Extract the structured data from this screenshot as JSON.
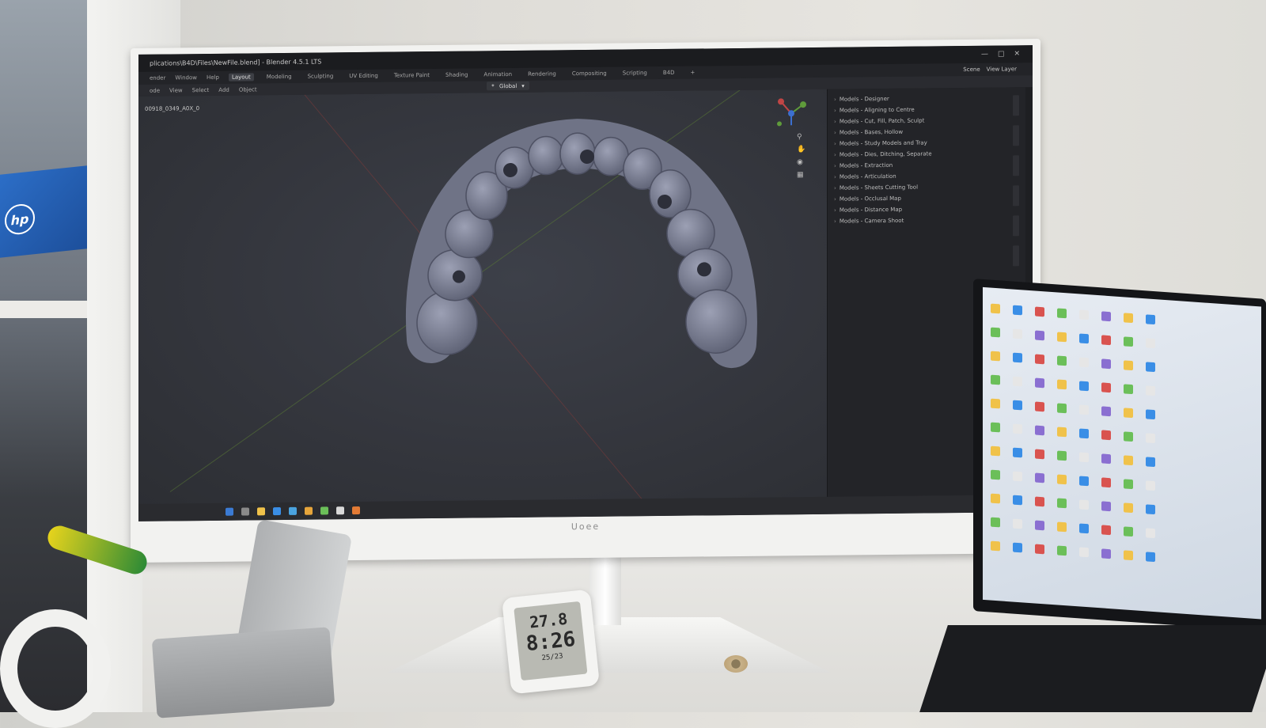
{
  "blender": {
    "window_title": "plications\\B4D\\Files\\NewFile.blend] - Blender 4.5.1 LTS",
    "menu": [
      "ender",
      "Window",
      "Help"
    ],
    "workspaces": [
      "Layout",
      "Modeling",
      "Sculpting",
      "UV Editing",
      "Texture Paint",
      "Shading",
      "Animation",
      "Rendering",
      "Compositing",
      "Scripting",
      "B4D",
      "+"
    ],
    "active_workspace": "Layout",
    "scene_label": "Scene",
    "view_layer_label": "View Layer",
    "header_items": [
      "ode",
      "View",
      "Select",
      "Add",
      "Object"
    ],
    "transform_orientation": "Global",
    "object_name": "00918_0349_A0X_0",
    "side_panel_items": [
      "Models - Designer",
      "Models - Aligning to Centre",
      "Models - Cut, Fill, Patch, Sculpt",
      "Models - Bases, Hollow",
      "Models - Study Models and Tray",
      "Models - Dies, Ditching, Separate",
      "Models - Extraction",
      "Models - Articulation",
      "Models - Sheets Cutting Tool",
      "Models - Occlusal Map",
      "Models - Distance Map",
      "Models - Camera Shoot"
    ],
    "colors": {
      "viewport": "#34363d",
      "panel": "#232428",
      "model": "#7b7f93"
    }
  },
  "monitor": {
    "brand": "Uoee"
  },
  "thermometer": {
    "line1": "27.8",
    "line2": "8:26",
    "line3": "25/23"
  },
  "hp_box": {
    "logo": "hp"
  }
}
